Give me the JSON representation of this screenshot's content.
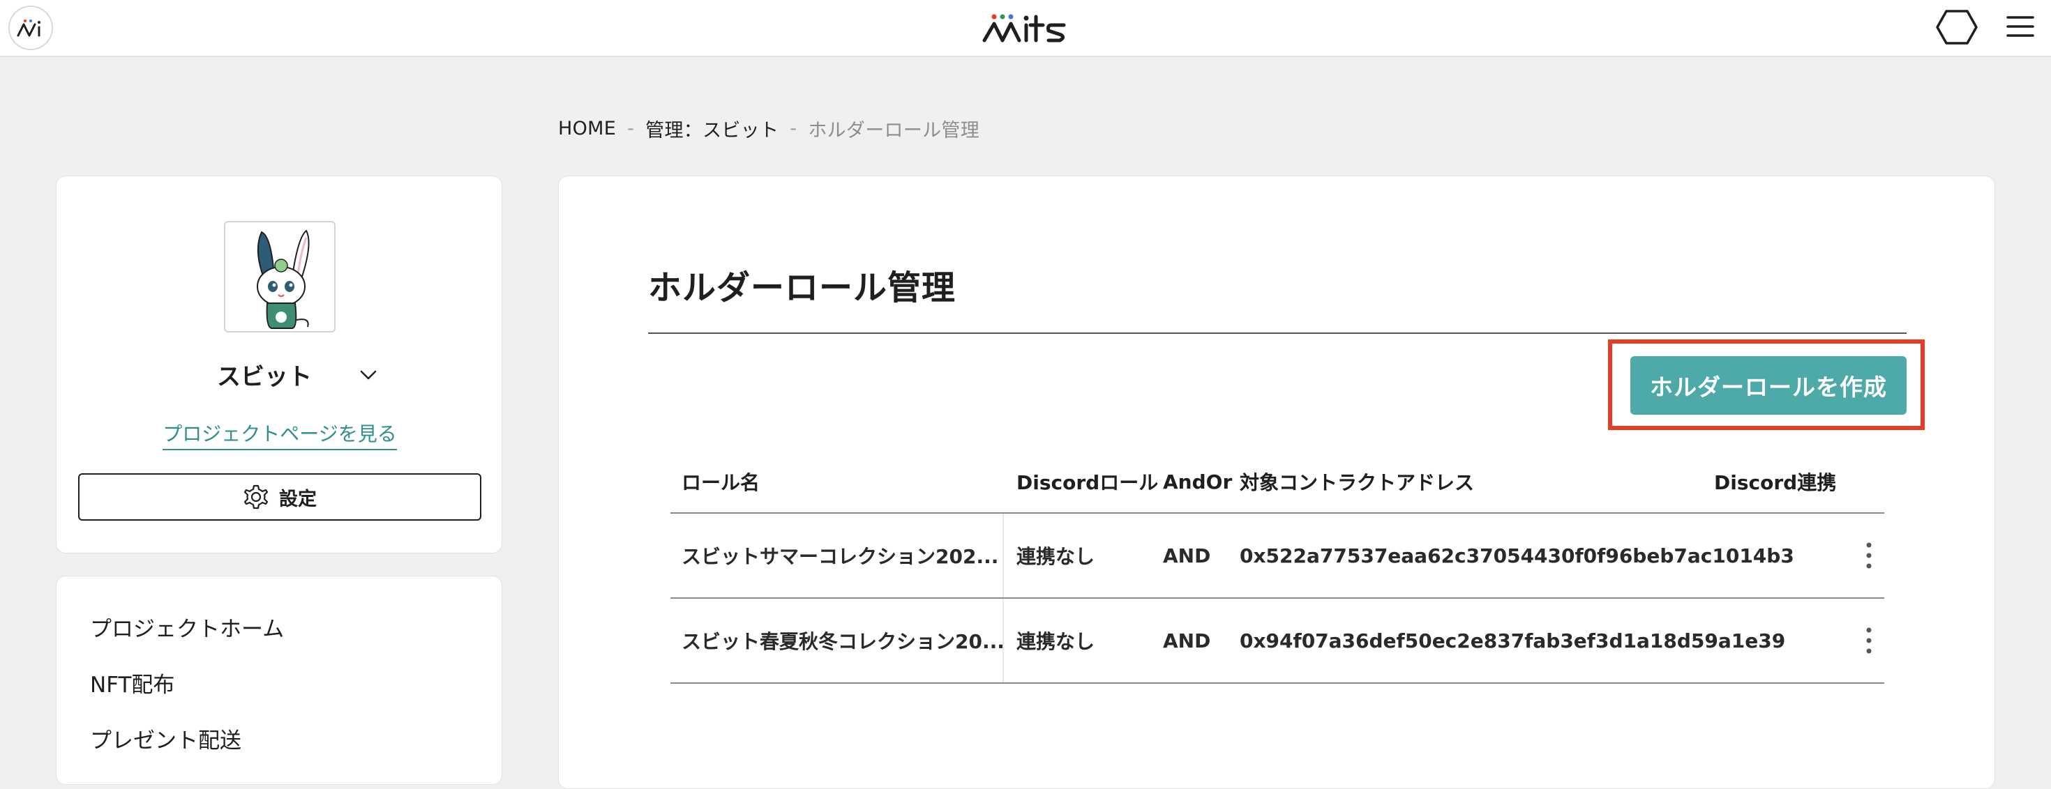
{
  "header": {
    "brand": "mits",
    "site_icon": "mi-logo-icon",
    "right_icons": [
      "hexagon-wallet-icon",
      "hamburger-menu-icon"
    ]
  },
  "breadcrumb": {
    "home": "HOME",
    "separator": "-",
    "project": "管理：スビット",
    "current": "ホルダーロール管理"
  },
  "sidebar": {
    "project_name": "スビット",
    "project_page_link": "プロジェクトページを見る",
    "settings_label": "設定",
    "nav_items": [
      "プロジェクトホーム",
      "NFT配布",
      "プレゼント配送"
    ]
  },
  "main": {
    "title": "ホルダーロール管理",
    "create_button": "ホルダーロールを作成",
    "table": {
      "headers": [
        "ロール名",
        "Discordロール",
        "AndOr",
        "対象コントラクトアドレス",
        "Discord連携"
      ],
      "rows": [
        {
          "role_name": "スビットサマーコレクション202...",
          "discord_role": "連携なし",
          "andor": "AND",
          "address": "0x522a77537eaa62c37054430f0f96beb7ac1014b3",
          "discord_link": ""
        },
        {
          "role_name": "スビット春夏秋冬コレクション20...",
          "discord_role": "連携なし",
          "andor": "AND",
          "address": "0x94f07a36def50ec2e837fab3ef3d1a18d59a1e39",
          "discord_link": ""
        }
      ]
    }
  },
  "colors": {
    "accent": "#4eaaa8",
    "link": "#2f8f8c",
    "highlight": "#e63b24",
    "background": "#f0f0f0"
  }
}
